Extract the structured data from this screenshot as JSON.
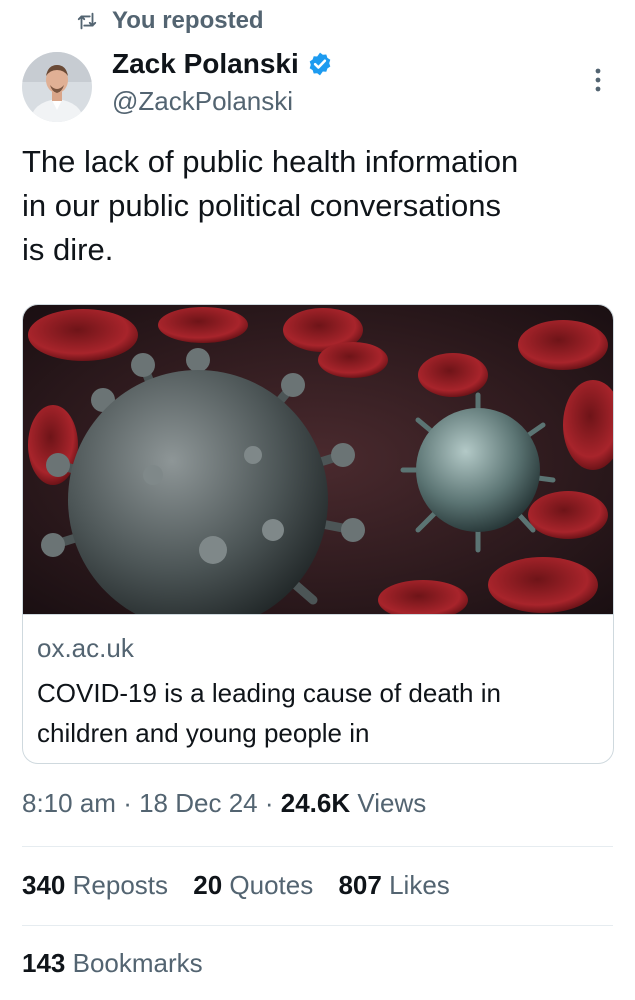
{
  "repost_header": {
    "text": "You reposted",
    "icon": "repost-icon"
  },
  "author": {
    "display_name": "Zack Polanski",
    "handle": "@ZackPolanski",
    "verified": true,
    "verified_color": "#1d9bf0"
  },
  "tweet": {
    "text": "The lack of public health information\nin our public political conversations\nis dire."
  },
  "link_card": {
    "image": "virus-illustration",
    "domain": "ox.ac.uk",
    "title": "COVID-19 is a leading cause of death in\nchildren and young people in"
  },
  "meta": {
    "time": "8:10 am",
    "separator": "·",
    "date": "18 Dec 24",
    "views_count": "24.6K",
    "views_label": "Views"
  },
  "stats": {
    "reposts": {
      "count": "340",
      "label": "Reposts"
    },
    "quotes": {
      "count": "20",
      "label": "Quotes"
    },
    "likes": {
      "count": "807",
      "label": "Likes"
    }
  },
  "bookmarks": {
    "count": "143",
    "label": "Bookmarks"
  },
  "colors": {
    "text": "#0f1419",
    "secondary": "#536471",
    "border": "#cfd9de",
    "accent": "#1d9bf0"
  }
}
